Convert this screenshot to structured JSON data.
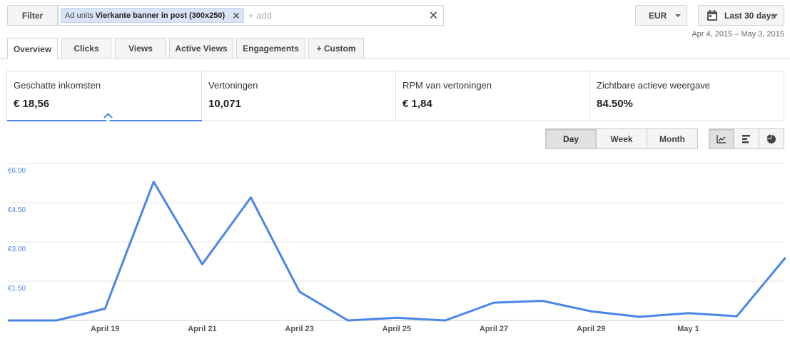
{
  "filter": {
    "button_label": "Filter",
    "chip_key": "Ad units",
    "chip_value": "Vierkante banner in post (300x250)",
    "add_placeholder": "+ add"
  },
  "currency": {
    "label": "EUR"
  },
  "date": {
    "label": "Last 30 days",
    "range": "Apr 4, 2015 – May 3, 2015"
  },
  "tabs": [
    {
      "label": "Overview",
      "active": true
    },
    {
      "label": "Clicks"
    },
    {
      "label": "Views"
    },
    {
      "label": "Active Views"
    },
    {
      "label": "Engagements"
    },
    {
      "label": "+  Custom"
    }
  ],
  "metrics": [
    {
      "label": "Geschatte inkomsten",
      "value": "€ 18,56",
      "active": true
    },
    {
      "label": "Vertoningen",
      "value": "10,071"
    },
    {
      "label": "RPM van vertoningen",
      "value": "€ 1,84"
    },
    {
      "label": "Zichtbare actieve weergave",
      "value": "84.50%"
    }
  ],
  "granularity": {
    "options": [
      "Day",
      "Week",
      "Month"
    ],
    "selected": "Day"
  },
  "chart_types": [
    "line-chart-icon",
    "bar-chart-icon",
    "pie-chart-icon"
  ],
  "colors": {
    "line": "#4a86e8",
    "axis_text": "#4a86e8",
    "grid": "#e5e5e5"
  },
  "chart_data": {
    "type": "line",
    "ylim": [
      0,
      6
    ],
    "yticks": [
      1.5,
      3.0,
      4.5,
      6.0
    ],
    "ytick_labels": [
      "€1.50",
      "€3.00",
      "€4.50",
      "€6.00"
    ],
    "xtick_labels": [
      {
        "label": "April 19",
        "day": 2
      },
      {
        "label": "April 21",
        "day": 4
      },
      {
        "label": "April 23",
        "day": 6
      },
      {
        "label": "April 25",
        "day": 8
      },
      {
        "label": "April 27",
        "day": 10
      },
      {
        "label": "April 29",
        "day": 12
      },
      {
        "label": "May 1",
        "day": 14
      }
    ],
    "series": [
      {
        "dates": [
          "Apr 17",
          "Apr 18",
          "Apr 19",
          "Apr 20",
          "Apr 21",
          "Apr 22",
          "Apr 23",
          "Apr 24",
          "Apr 25",
          "Apr 26",
          "Apr 27",
          "Apr 28",
          "Apr 29",
          "Apr 30",
          "May 1",
          "May 2",
          "May 3"
        ],
        "values": [
          0.0,
          0.0,
          0.45,
          5.3,
          2.15,
          4.7,
          1.1,
          0.0,
          0.1,
          0.0,
          0.68,
          0.75,
          0.35,
          0.14,
          0.28,
          0.16,
          2.4
        ]
      }
    ]
  }
}
